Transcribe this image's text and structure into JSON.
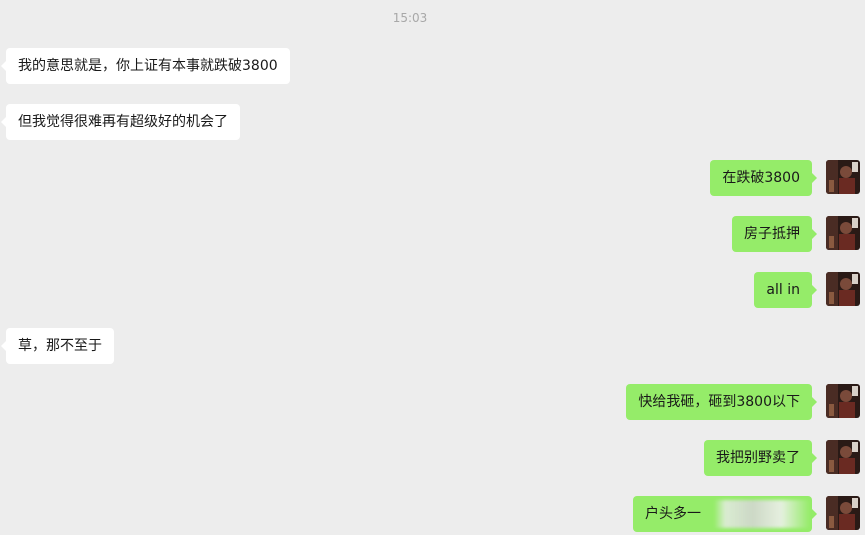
{
  "timestamp": "15:03",
  "messages": [
    {
      "side": "left",
      "text": "我的意思就是，你上证有本事就跌破3800"
    },
    {
      "side": "left",
      "text": "但我觉得很难再有超级好的机会了"
    },
    {
      "side": "right",
      "text": "在跌破3800"
    },
    {
      "side": "right",
      "text": "房子抵押"
    },
    {
      "side": "right",
      "text": "all in"
    },
    {
      "side": "left",
      "text": "草，那不至于"
    },
    {
      "side": "right",
      "text": "快给我砸，砸到3800以下"
    },
    {
      "side": "right",
      "text": "我把别野卖了"
    },
    {
      "side": "right",
      "text": "户头多一"
    }
  ],
  "colors": {
    "background": "#ededed",
    "incoming_bubble": "#ffffff",
    "outgoing_bubble": "#95ec69",
    "timestamp_text": "#a8a8a8"
  },
  "avatar": {
    "icon": "user-avatar-icon"
  }
}
